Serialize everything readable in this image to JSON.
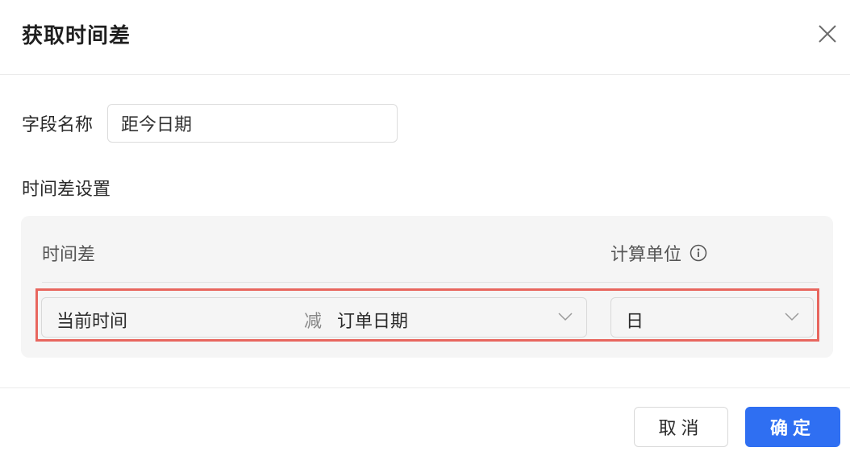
{
  "dialog": {
    "title": "获取时间差",
    "close_icon": "close-icon"
  },
  "form": {
    "field_name_label": "字段名称",
    "field_name_value": "距今日期",
    "section_title": "时间差设置",
    "diff_header": "时间差",
    "unit_header": "计算单位",
    "unit_info_icon": "info-icon",
    "diff": {
      "start": "当前时间",
      "operator": "减",
      "end": "订单日期"
    },
    "unit_value": "日",
    "highlight_color": "#e8665e"
  },
  "footer": {
    "cancel_label": "取消",
    "confirm_label": "确定",
    "confirm_color": "#2f6ff2"
  }
}
